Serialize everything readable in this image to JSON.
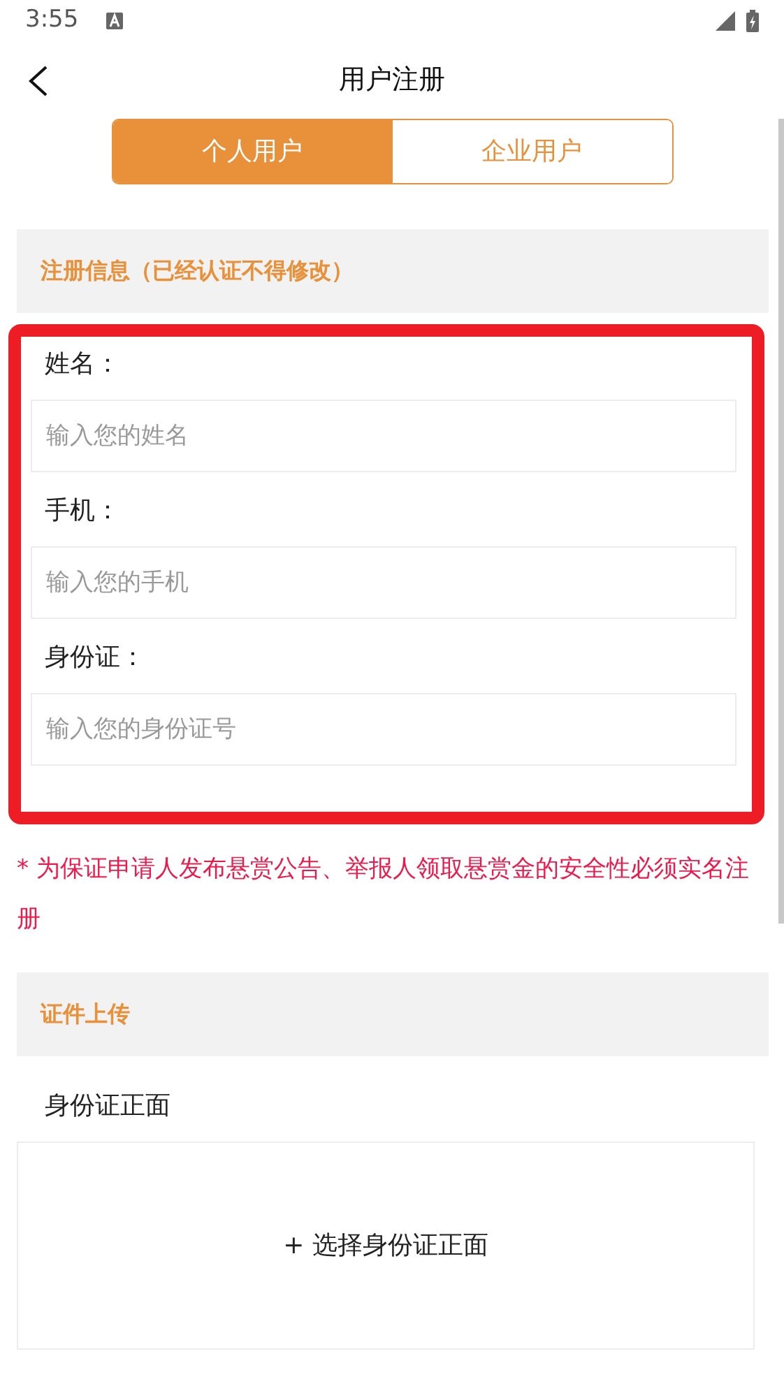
{
  "status_bar": {
    "time": "3:55"
  },
  "header": {
    "title": "用户注册"
  },
  "tabs": [
    {
      "label": "个人用户",
      "selected": true
    },
    {
      "label": "企业用户",
      "selected": false
    }
  ],
  "sections": [
    {
      "title": "注册信息（已经认证不得修改）"
    }
  ],
  "fields": [
    {
      "label": "姓名：",
      "placeholder": "输入您的姓名"
    },
    {
      "label": "手机：",
      "placeholder": "输入您的手机"
    },
    {
      "label": "身份证：",
      "placeholder": "输入您的身份证号"
    }
  ],
  "notice": "* 为保证申请人发布悬赏公告、举报人领取悬赏金的安全性必须实名注册",
  "upload_section": {
    "title": "证件上传",
    "items": [
      {
        "label": "身份证正面",
        "button": "+ 选择身份证正面"
      }
    ]
  }
}
